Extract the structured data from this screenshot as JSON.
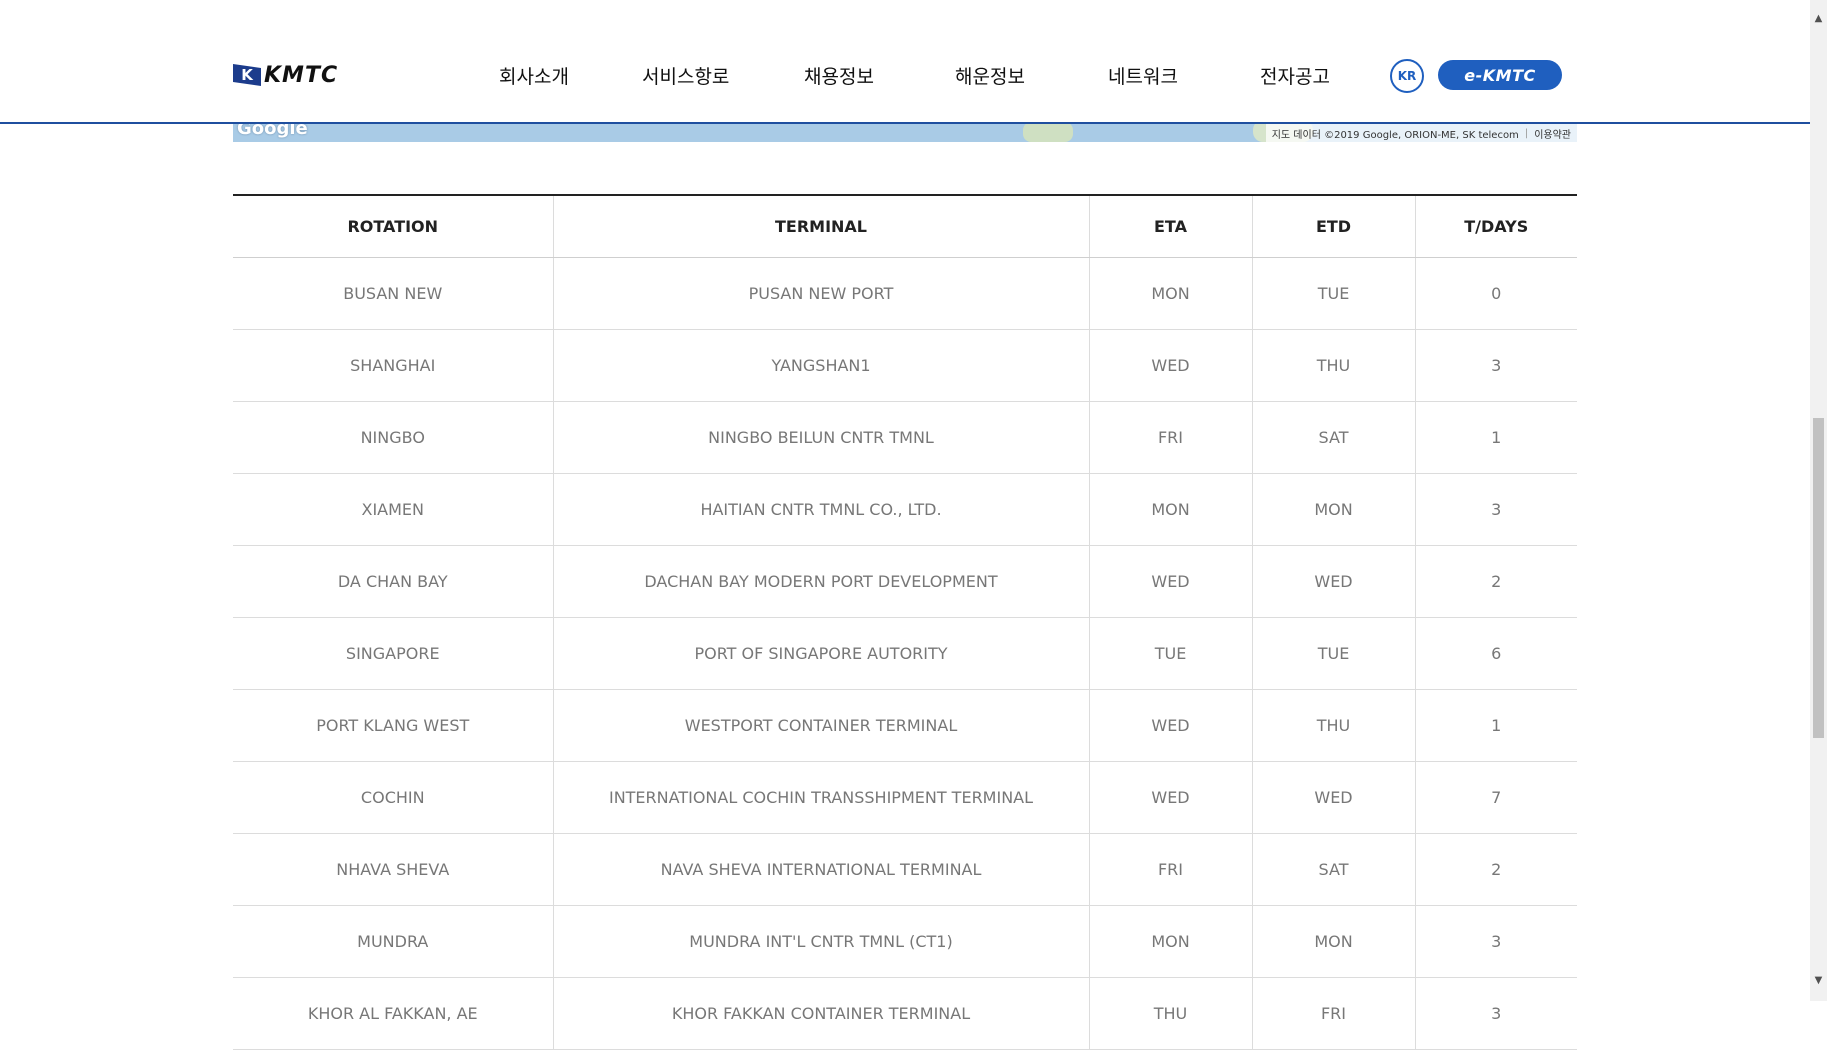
{
  "header": {
    "logo_text": "KMTC",
    "logo_flag_letter": "K",
    "nav": [
      "회사소개",
      "서비스항로",
      "채용정보",
      "해운정보",
      "네트워크",
      "전자공고"
    ],
    "lang_label": "KR",
    "ekmtc_label": "e-KMTC",
    "accent_color": "#1f5fbf"
  },
  "map": {
    "google_label": "Google",
    "attribution": "지도 데이터 ©2019 Google, ORION-ME, SK telecom",
    "terms": "이용약관"
  },
  "table": {
    "headers": [
      "ROTATION",
      "TERMINAL",
      "ETA",
      "ETD",
      "T/DAYS"
    ],
    "rows": [
      [
        "BUSAN NEW",
        "PUSAN NEW PORT",
        "MON",
        "TUE",
        "0"
      ],
      [
        "SHANGHAI",
        "YANGSHAN1",
        "WED",
        "THU",
        "3"
      ],
      [
        "NINGBO",
        "NINGBO BEILUN CNTR TMNL",
        "FRI",
        "SAT",
        "1"
      ],
      [
        "XIAMEN",
        "HAITIAN CNTR TMNL CO., LTD.",
        "MON",
        "MON",
        "3"
      ],
      [
        "DA CHAN BAY",
        "DACHAN BAY MODERN PORT DEVELOPMENT",
        "WED",
        "WED",
        "2"
      ],
      [
        "SINGAPORE",
        "PORT OF SINGAPORE AUTORITY",
        "TUE",
        "TUE",
        "6"
      ],
      [
        "PORT KLANG WEST",
        "WESTPORT CONTAINER TERMINAL",
        "WED",
        "THU",
        "1"
      ],
      [
        "COCHIN",
        "INTERNATIONAL COCHIN TRANSSHIPMENT TERMINAL",
        "WED",
        "WED",
        "7"
      ],
      [
        "NHAVA SHEVA",
        "NAVA SHEVA INTERNATIONAL TERMINAL",
        "FRI",
        "SAT",
        "2"
      ],
      [
        "MUNDRA",
        "MUNDRA INT'L CNTR TMNL (CT1)",
        "MON",
        "MON",
        "3"
      ],
      [
        "KHOR AL FAKKAN, AE",
        "KHOR FAKKAN CONTAINER TERMINAL",
        "THU",
        "FRI",
        "3"
      ]
    ]
  },
  "scrollbar": {
    "up_icon": "scroll-up-arrow",
    "down_icon": "scroll-down-arrow"
  }
}
